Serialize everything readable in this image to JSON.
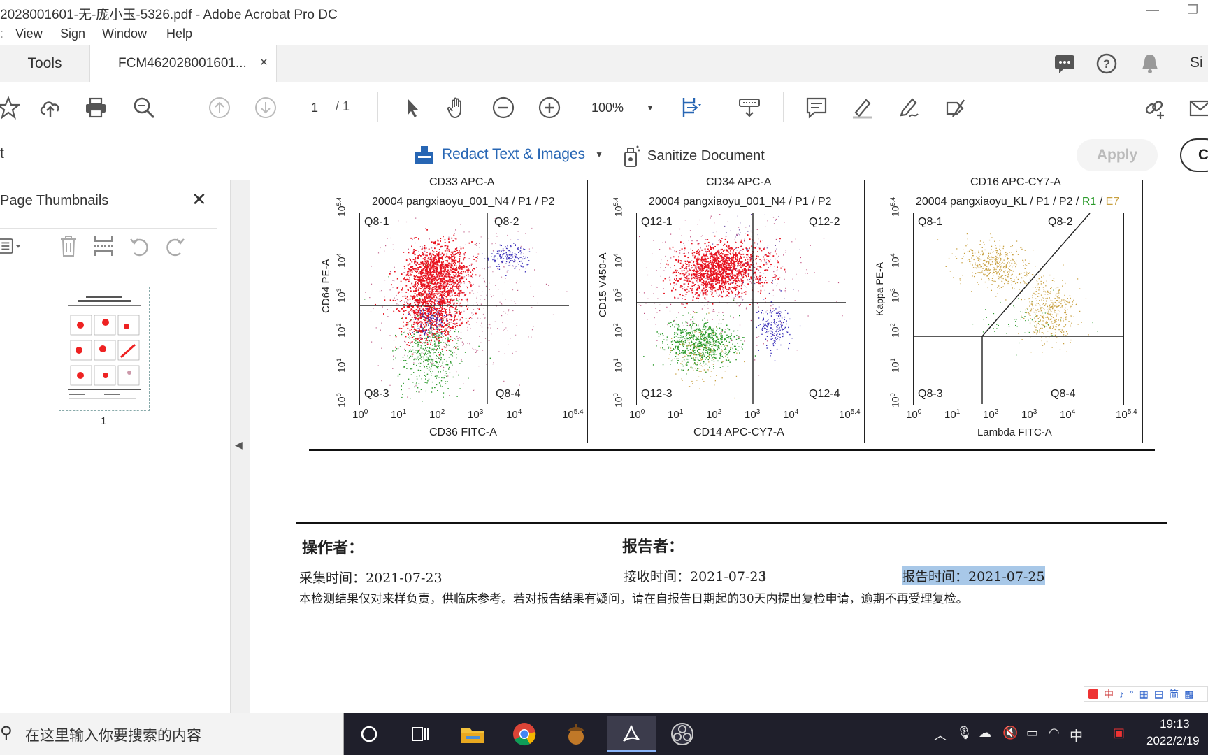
{
  "window": {
    "title": "2028001601-无-庞小玉-5326.pdf - Adobe Acrobat Pro DC"
  },
  "menu": {
    "items": [
      "View",
      "Sign",
      "Window",
      "Help"
    ]
  },
  "tabs": {
    "tools": "Tools",
    "doc": "FCM462028001601...",
    "close": "×",
    "signin": "Si"
  },
  "toolbar": {
    "page_current": "1",
    "page_sep_total": "/  1",
    "zoom": "100%"
  },
  "redact": {
    "redact_label": "Redact Text & Images",
    "sanitize_label": "Sanitize Document",
    "apply": "Apply",
    "close": "C",
    "left_char": "t"
  },
  "panel": {
    "title": "Page Thumbnails",
    "close": "✕",
    "thumb_num": "1"
  },
  "plots": {
    "top": [
      "CD33  APC-A",
      "CD34  APC-A",
      "CD16  APC-CY7-A"
    ],
    "p1": {
      "title": "20004 pangxiaoyu_001_N4 / P1 / P2",
      "x": "CD36  FITC-A",
      "y": "CD64  PE-A",
      "q1": "Q8-1",
      "q2": "Q8-2",
      "q3": "Q8-3",
      "q4": "Q8-4"
    },
    "p2": {
      "title": "20004 pangxiaoyu_001_N4 / P1 / P2",
      "x": "CD14  APC-CY7-A",
      "y": "CD15  V450-A",
      "q1": "Q12-1",
      "q2": "Q12-2",
      "q3": "Q12-3",
      "q4": "Q12-4"
    },
    "p3": {
      "title_main": "20004 pangxiaoyu_KL / P1 / P2 /",
      "title_r1": "R1",
      "title_e7": "E7",
      "x": "Lambda  FITC-A",
      "y": "Kappa  PE-A",
      "q1": "Q8-1",
      "q2": "Q8-2",
      "q3": "Q8-3",
      "q4": "Q8-4"
    },
    "ticks": [
      "10",
      "10",
      "10",
      "10",
      "10",
      "10"
    ],
    "tick_exp": [
      "0",
      "1",
      "2",
      "3",
      "4",
      "5.4"
    ]
  },
  "report": {
    "operator": "操作者：",
    "reporter": "报告者：",
    "collect": "采集时间：2021-07-23",
    "receive": "接收时间：2021-07-23",
    "report_time": "报告时间：2021-07-25",
    "disclaimer": "本检测结果仅对来样负责，供临床参考。若对报告结果有疑问，请在自报告日期起的30天内提出复检申请，逾期不再受理复检。"
  },
  "ime": {
    "items": [
      "中",
      "♪",
      "°",
      "简"
    ]
  },
  "taskbar": {
    "search": "在这里输入你要搜索的内容",
    "tray_lang": "中",
    "time": "19:13",
    "date": "2022/2/19"
  },
  "colors": {
    "accent": "#2766b4",
    "red": "#e8121e",
    "green": "#2b9a2b",
    "blue": "#3a2fb8",
    "gold": "#c8a040"
  }
}
